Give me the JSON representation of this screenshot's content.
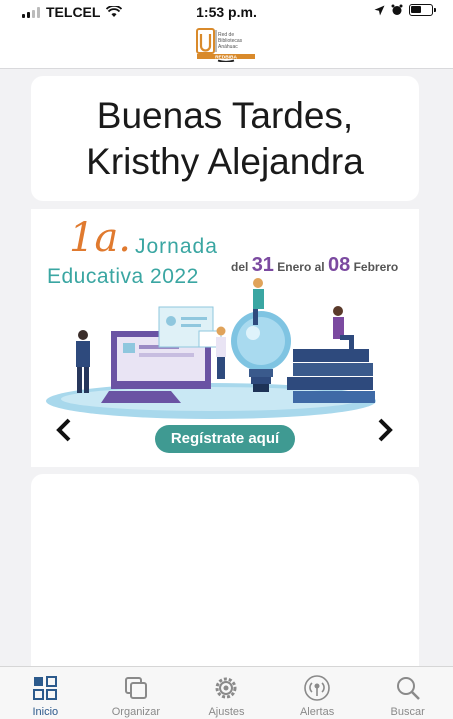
{
  "status_bar": {
    "carrier": "TELCEL",
    "time": "1:53 p.m."
  },
  "header": {
    "logo_line1": "Red de",
    "logo_line2": "Bibliotecas",
    "logo_line3": "Anáhuac",
    "logo_brand": "REDBIBA"
  },
  "greeting": {
    "line1": "Buenas Tardes,",
    "line2": "Kristhy Alejandra"
  },
  "banner": {
    "number": "1a.",
    "title_word": "Jornada",
    "subtitle": "Educativa 2022",
    "dates_prefix": "del",
    "start_day": "31",
    "start_month": "Enero al",
    "end_day": "08",
    "end_month": "Febrero",
    "cta_label": "Regístrate aquí"
  },
  "tabs": [
    {
      "label": "Inicio",
      "icon": "grid-icon",
      "active": true
    },
    {
      "label": "Organizar",
      "icon": "copy-icon",
      "active": false
    },
    {
      "label": "Ajustes",
      "icon": "gear-icon",
      "active": false
    },
    {
      "label": "Alertas",
      "icon": "broadcast-icon",
      "active": false
    },
    {
      "label": "Buscar",
      "icon": "search-icon",
      "active": false
    }
  ],
  "colors": {
    "accent_blue": "#2c5a8c",
    "banner_teal": "#3f9a92",
    "banner_orange": "#e07a2f",
    "banner_purple": "#7b4aa0"
  }
}
